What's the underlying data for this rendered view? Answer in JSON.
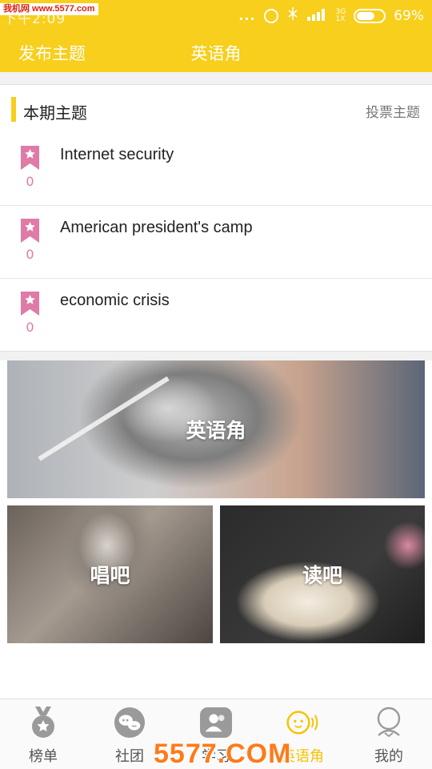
{
  "watermark_top": "我机网 www.5577.com",
  "statusbar": {
    "time": "下午2:09",
    "dots": "...",
    "network_top": "3G",
    "network_bottom": "1X",
    "battery": "69%",
    "battery_level_percent": 69
  },
  "header": {
    "publish_label": "发布主题",
    "title": "英语角"
  },
  "section": {
    "title": "本期主题",
    "vote_label": "投票主题"
  },
  "topics": [
    {
      "title": "Internet security",
      "count": "0"
    },
    {
      "title": "American president's camp",
      "count": "0"
    },
    {
      "title": "economic crisis",
      "count": "0"
    }
  ],
  "cards": {
    "english_corner": "英语角",
    "sing": "唱吧",
    "read": "读吧"
  },
  "nav": {
    "tabs": [
      {
        "label": "榜单",
        "icon": "medal-icon"
      },
      {
        "label": "社团",
        "icon": "chat-bubbles-icon"
      },
      {
        "label": "学习",
        "icon": "people-icon"
      },
      {
        "label": "英语角",
        "icon": "smiley-sound-icon"
      },
      {
        "label": "我的",
        "icon": "user-icon"
      }
    ],
    "active_tab": "英语角"
  },
  "watermark_bottom": "5577.COM",
  "colors": {
    "accent": "#f7cf1c",
    "bookmark": "#e07aa6",
    "active_tab": "#f5c400"
  }
}
